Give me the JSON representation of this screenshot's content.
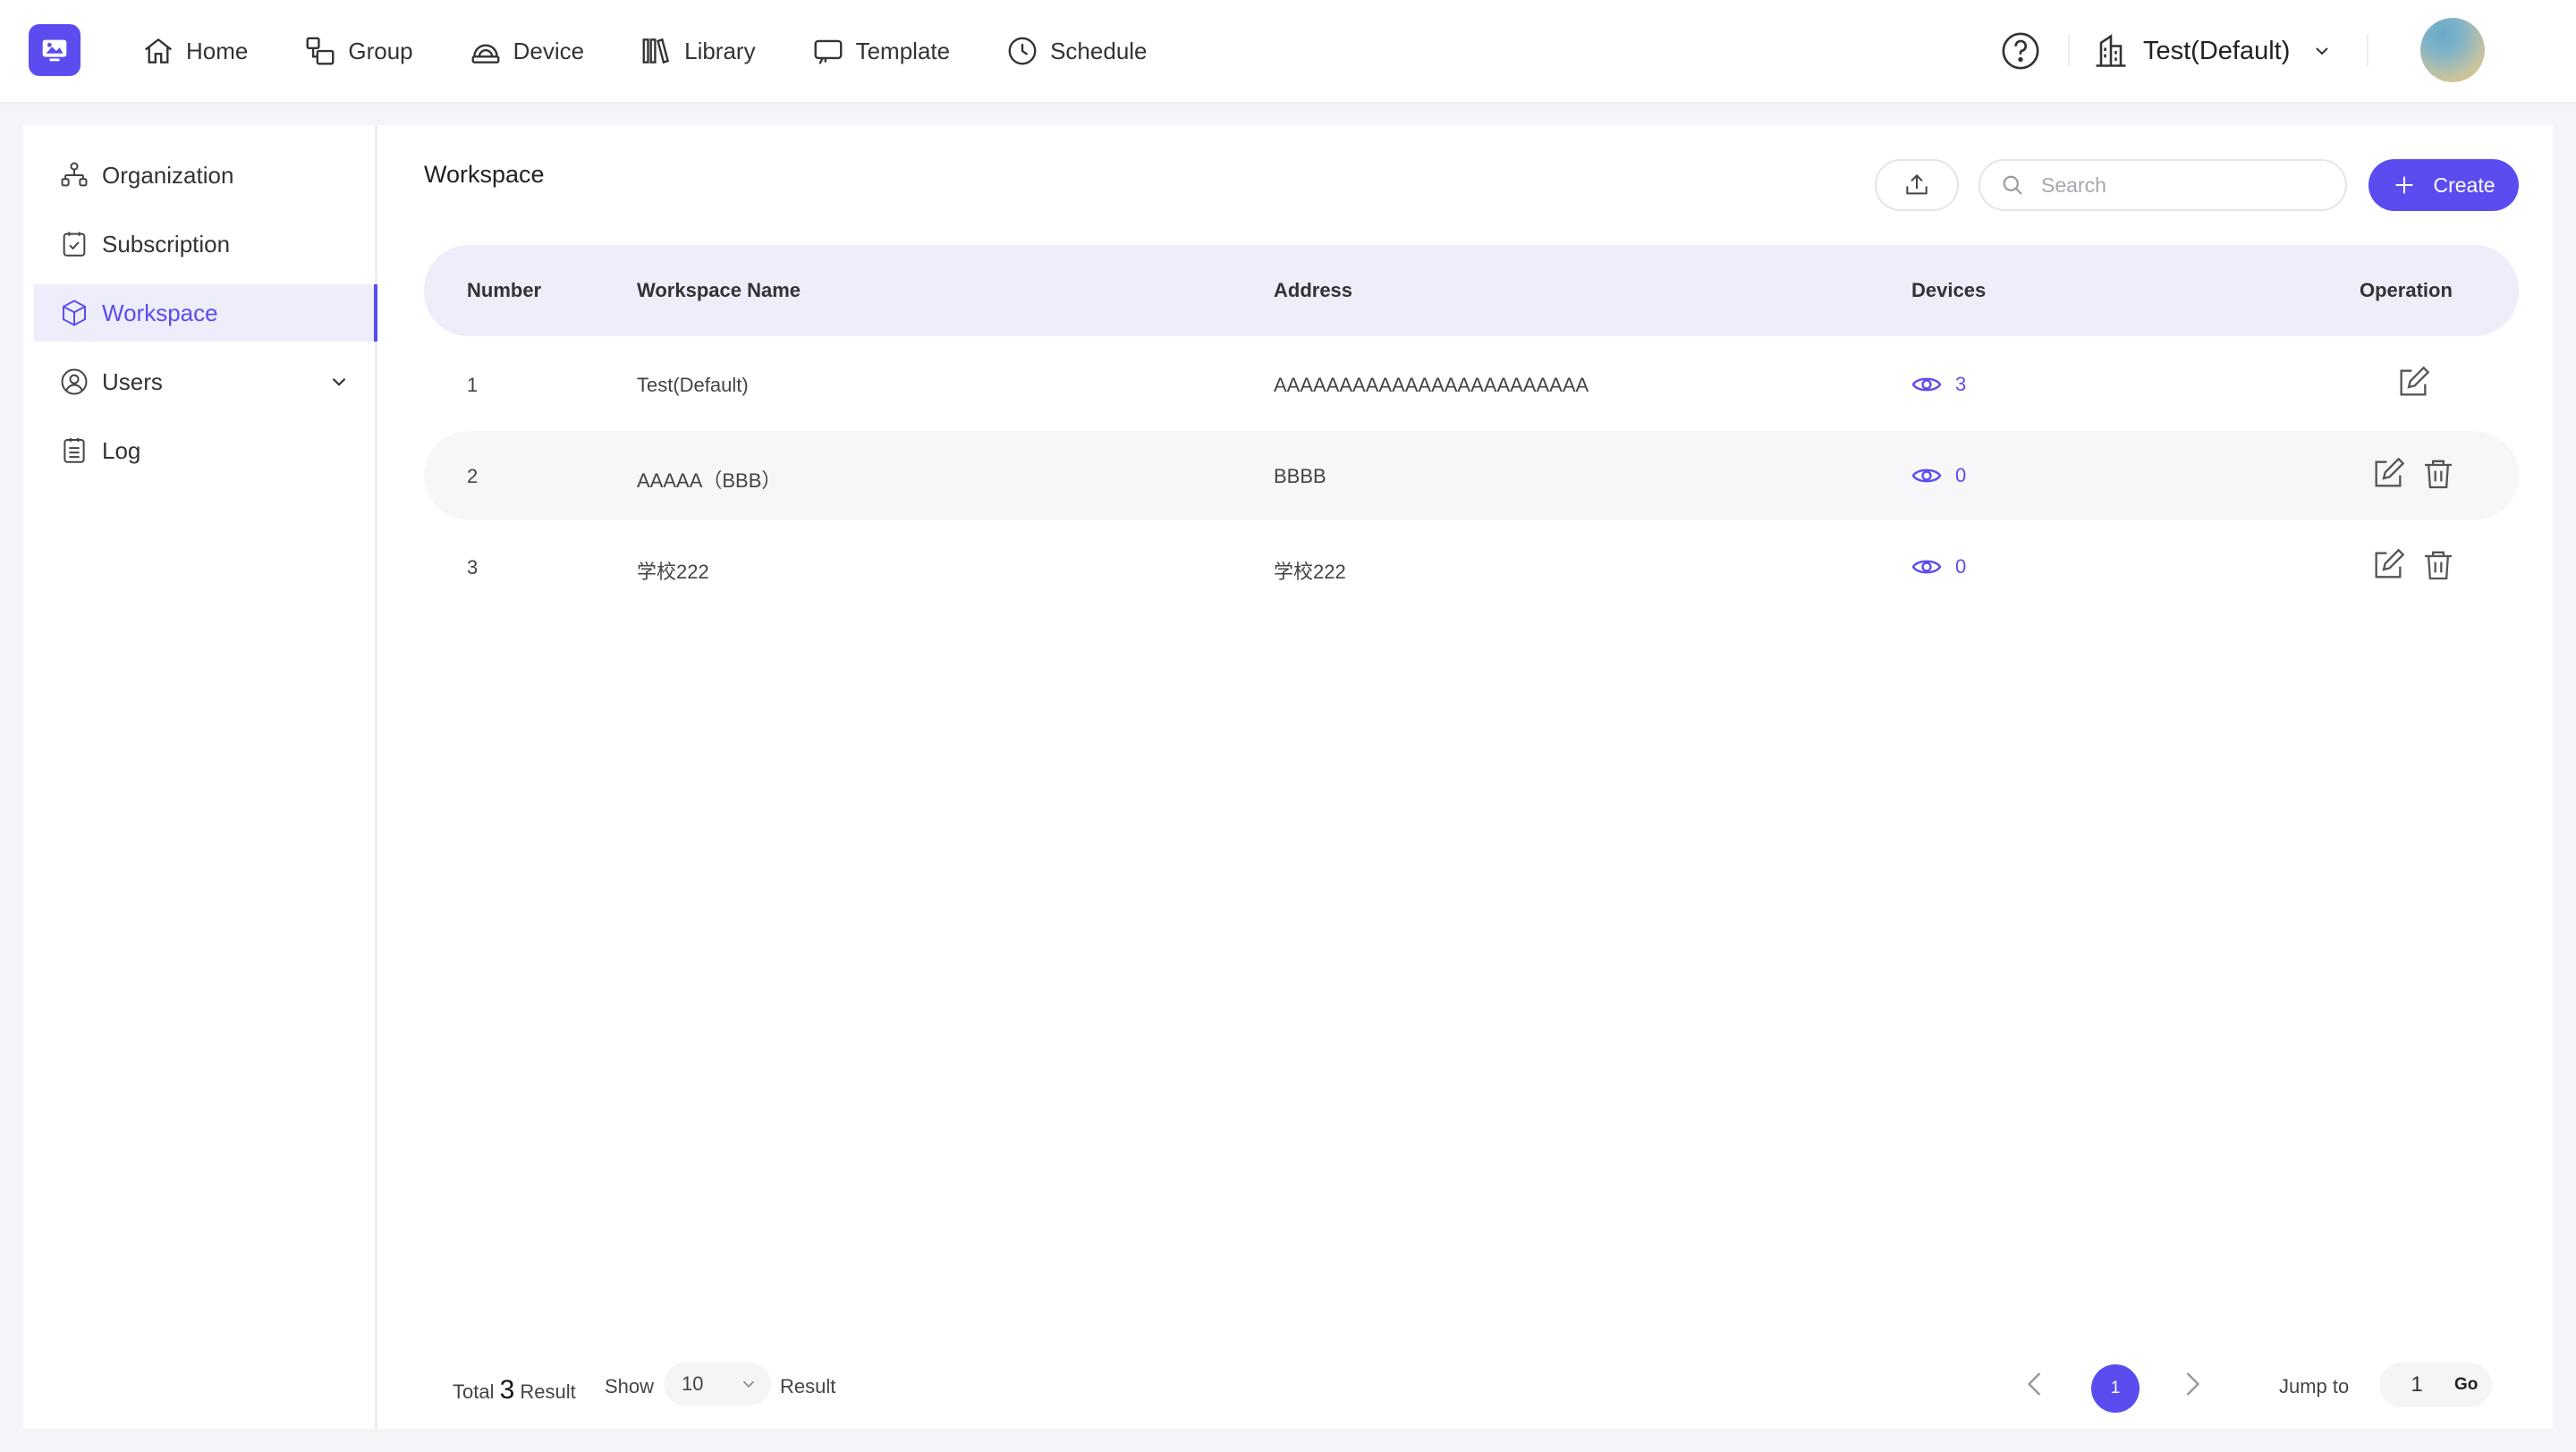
{
  "colors": {
    "accent": "#5b4cf0",
    "accent_light": "#eeedfc",
    "header_bg": "#eeedf9"
  },
  "nav": {
    "items": [
      {
        "label": "Home",
        "icon": "home-icon"
      },
      {
        "label": "Group",
        "icon": "group-icon"
      },
      {
        "label": "Device",
        "icon": "device-icon"
      },
      {
        "label": "Library",
        "icon": "library-icon"
      },
      {
        "label": "Template",
        "icon": "template-icon"
      },
      {
        "label": "Schedule",
        "icon": "clock-icon"
      }
    ],
    "org": "Test(Default)"
  },
  "sidebar": {
    "items": [
      {
        "label": "Organization",
        "icon": "organization-icon"
      },
      {
        "label": "Subscription",
        "icon": "subscription-icon"
      },
      {
        "label": "Workspace",
        "icon": "cube-icon",
        "active": true
      },
      {
        "label": "Users",
        "icon": "user-icon"
      },
      {
        "label": "Log",
        "icon": "log-icon"
      }
    ]
  },
  "main": {
    "title": "Workspace",
    "search_placeholder": "Search",
    "create_label": "Create",
    "columns": [
      "Number",
      "Workspace Name",
      "Address",
      "Devices",
      "Operation"
    ],
    "rows": [
      {
        "number": "1",
        "name": "Test(Default)",
        "address": "AAAAAAAAAAAAAAAAAAAAAAAA",
        "devices": "3"
      },
      {
        "number": "2",
        "name": "AAAAA（BBB）",
        "address": "BBBB",
        "devices": "0"
      },
      {
        "number": "3",
        "name": "学校222",
        "address": "学校222",
        "devices": "0"
      }
    ]
  },
  "pagination": {
    "total_prefix": "Total",
    "total": "3",
    "total_suffix": "Result",
    "show_label": "Show",
    "page_size": "10",
    "result_label": "Result",
    "current_page": "1",
    "jump_label": "Jump to",
    "jump_value": "1",
    "go_label": "Go"
  }
}
